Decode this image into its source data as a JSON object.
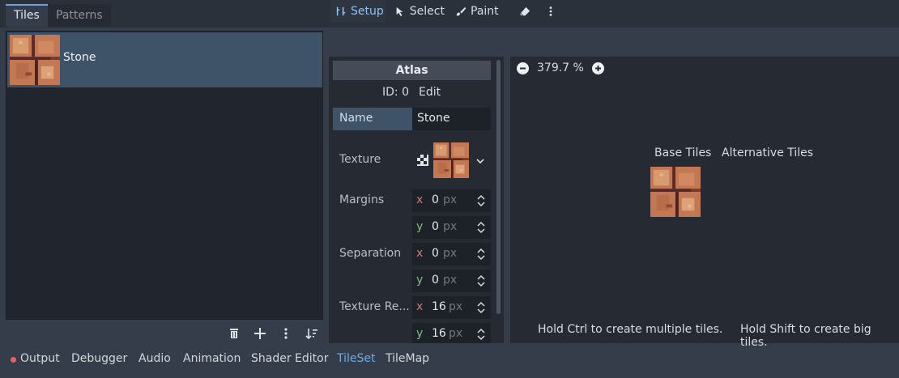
{
  "top_tabs": [
    {
      "label": "Tiles"
    },
    {
      "label": "Patterns"
    }
  ],
  "tiles_list": [
    {
      "name": "Stone"
    }
  ],
  "middle_toolbar": {
    "setup": "Setup",
    "select": "Select",
    "paint": "Paint"
  },
  "atlas": {
    "header": "Atlas",
    "id_label": "ID: 0",
    "edit_label": "Edit",
    "name_label": "Name",
    "name_value": "Stone",
    "texture_label": "Texture",
    "margins_label": "Margins",
    "separation_label": "Separation",
    "texture_region_label": "Texture Re...",
    "margins": {
      "x": "0",
      "y": "0"
    },
    "separation": {
      "x": "0",
      "y": "0"
    },
    "texture_region": {
      "x": "16",
      "y": "16"
    },
    "unit": "px",
    "axis_x": "x",
    "axis_y": "y"
  },
  "viewer": {
    "zoom": "379.7 %",
    "base_tiles": "Base Tiles",
    "alternative_tiles": "Alternative Tiles",
    "hint_ctrl": "Hold Ctrl to create multiple tiles.",
    "hint_shift": "Hold Shift to create big tiles."
  },
  "bottom_tabs": [
    {
      "label": "Output"
    },
    {
      "label": "Debugger"
    },
    {
      "label": "Audio"
    },
    {
      "label": "Animation"
    },
    {
      "label": "Shader Editor"
    },
    {
      "label": "TileSet"
    },
    {
      "label": "TileMap"
    }
  ],
  "colors": {
    "accent": "#6fa9e8",
    "output_dot": "#e86060",
    "selected_item": "#3e5268"
  },
  "icons": [
    "trash-icon",
    "add-icon",
    "more-vertical-icon",
    "sort-icon",
    "wrench-icon",
    "cursor-icon",
    "brush-icon",
    "eraser-icon",
    "zoom-out-icon",
    "zoom-in-icon",
    "checker-icon",
    "chevron-down-icon",
    "updown-arrow-icon"
  ]
}
